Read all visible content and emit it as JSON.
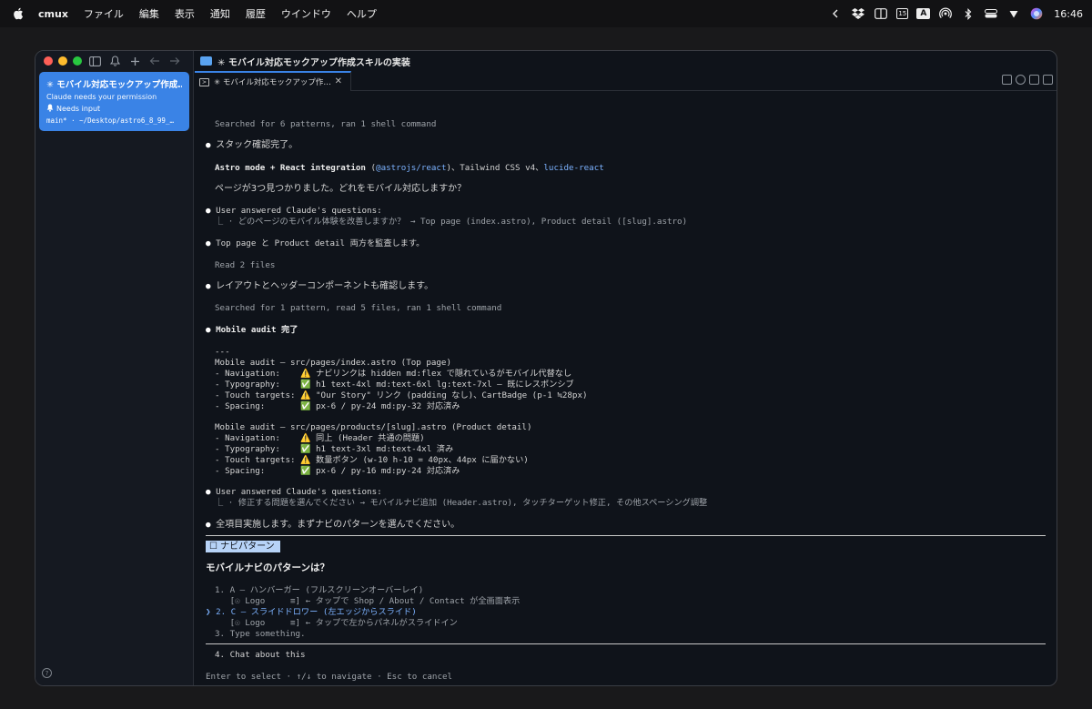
{
  "menubar": {
    "app_name": "cmux",
    "items": [
      "ファイル",
      "編集",
      "表示",
      "通知",
      "履歴",
      "ウインドウ",
      "ヘルプ"
    ],
    "calendar_day": "15",
    "input_mode": "A",
    "clock": "16:46"
  },
  "window": {
    "title": "✳ モバイル対応モックアップ作成スキルの実装"
  },
  "sidebar": {
    "workspace": {
      "title": "✳ モバイル対応モックアップ作成…",
      "subtitle": "Claude needs your permission",
      "status": "Needs input",
      "path": "main* · ~/Desktop/astro6_8_99_…"
    },
    "help_label": "?"
  },
  "tab": {
    "title": "✳ モバイル対応モックアップ作…",
    "close": "✕"
  },
  "terminal": {
    "l01": "Searched for 6 patterns, ran 1 shell command",
    "l02": "スタック確認完了。",
    "l03a": "Astro mode + React integration",
    "l03b": " (",
    "l03c": "@astrojs/react",
    "l03d": ")、Tailwind CSS v4、",
    "l03e": "lucide-react",
    "l04": "ページが3つ見つかりました。どれをモバイル対応しますか？",
    "l05": "User answered Claude's questions:",
    "l06": "⎿ · どのページのモバイル体験を改善しますか？ → Top page (index.astro), Product detail ([slug].astro)",
    "l07": "Top page と Product detail 両方を監査します。",
    "l08": "Read 2 files",
    "l09": "レイアウトとヘッダーコンポーネントも確認します。",
    "l10": "Searched for 1 pattern, read 5 files, ran 1 shell command",
    "l11": "Mobile audit 完了",
    "l12": "---",
    "l13": "Mobile audit — src/pages/index.astro (Top page)",
    "l14": "- Navigation:    ⚠️ ナビリンクは hidden md:flex で隠れているがモバイル代替なし",
    "l15": "- Typography:    ✅ h1 text-4xl md:text-6xl lg:text-7xl — 既にレスポンシブ",
    "l16": "- Touch targets: ⚠️ \"Our Story\" リンク (padding なし)、CartBadge (p-1 ≒28px)",
    "l17": "- Spacing:       ✅ px-6 / py-24 md:py-32 対応済み",
    "l18": "Mobile audit — src/pages/products/[slug].astro (Product detail)",
    "l19": "- Navigation:    ⚠️ 同上 (Header 共通の問題)",
    "l20": "- Typography:    ✅ h1 text-3xl md:text-4xl 済み",
    "l21": "- Touch targets: ⚠️ 数量ボタン (w-10 h-10 = 40px、44px に届かない)",
    "l22": "- Spacing:       ✅ px-6 / py-16 md:py-24 対応済み",
    "l23": "User answered Claude's questions:",
    "l24": "⎿ · 修正する問題を選んでください → モバイルナビ追加 (Header.astro), タッチターゲット修正, その他スペーシング調整",
    "l25": "全項目実施します。まずナビのパターンを選んでください。",
    "chip": "☐ ナビパターン",
    "question": "モバイルナビのパターンは？",
    "o1": "1. A — ハンバーガー (フルスクリーンオーバーレイ)",
    "o1d": "   [☉ Logo     ≡] ← タップで Shop / About / Contact が全画面表示",
    "o2": "❯ 2. C — スライドドロワー (左エッジからスライド)",
    "o2d": "   [☉ Logo     ≡] ← タップで左からパネルがスライドイン",
    "o3": "3. Type something.",
    "o4": "4. Chat about this",
    "hint": "Enter to select · ↑/↓ to navigate · Esc to cancel"
  },
  "colors": {
    "accent": "#3a83e6",
    "terminal_bg": "#0f131a",
    "selection": "#7cb2ff"
  }
}
